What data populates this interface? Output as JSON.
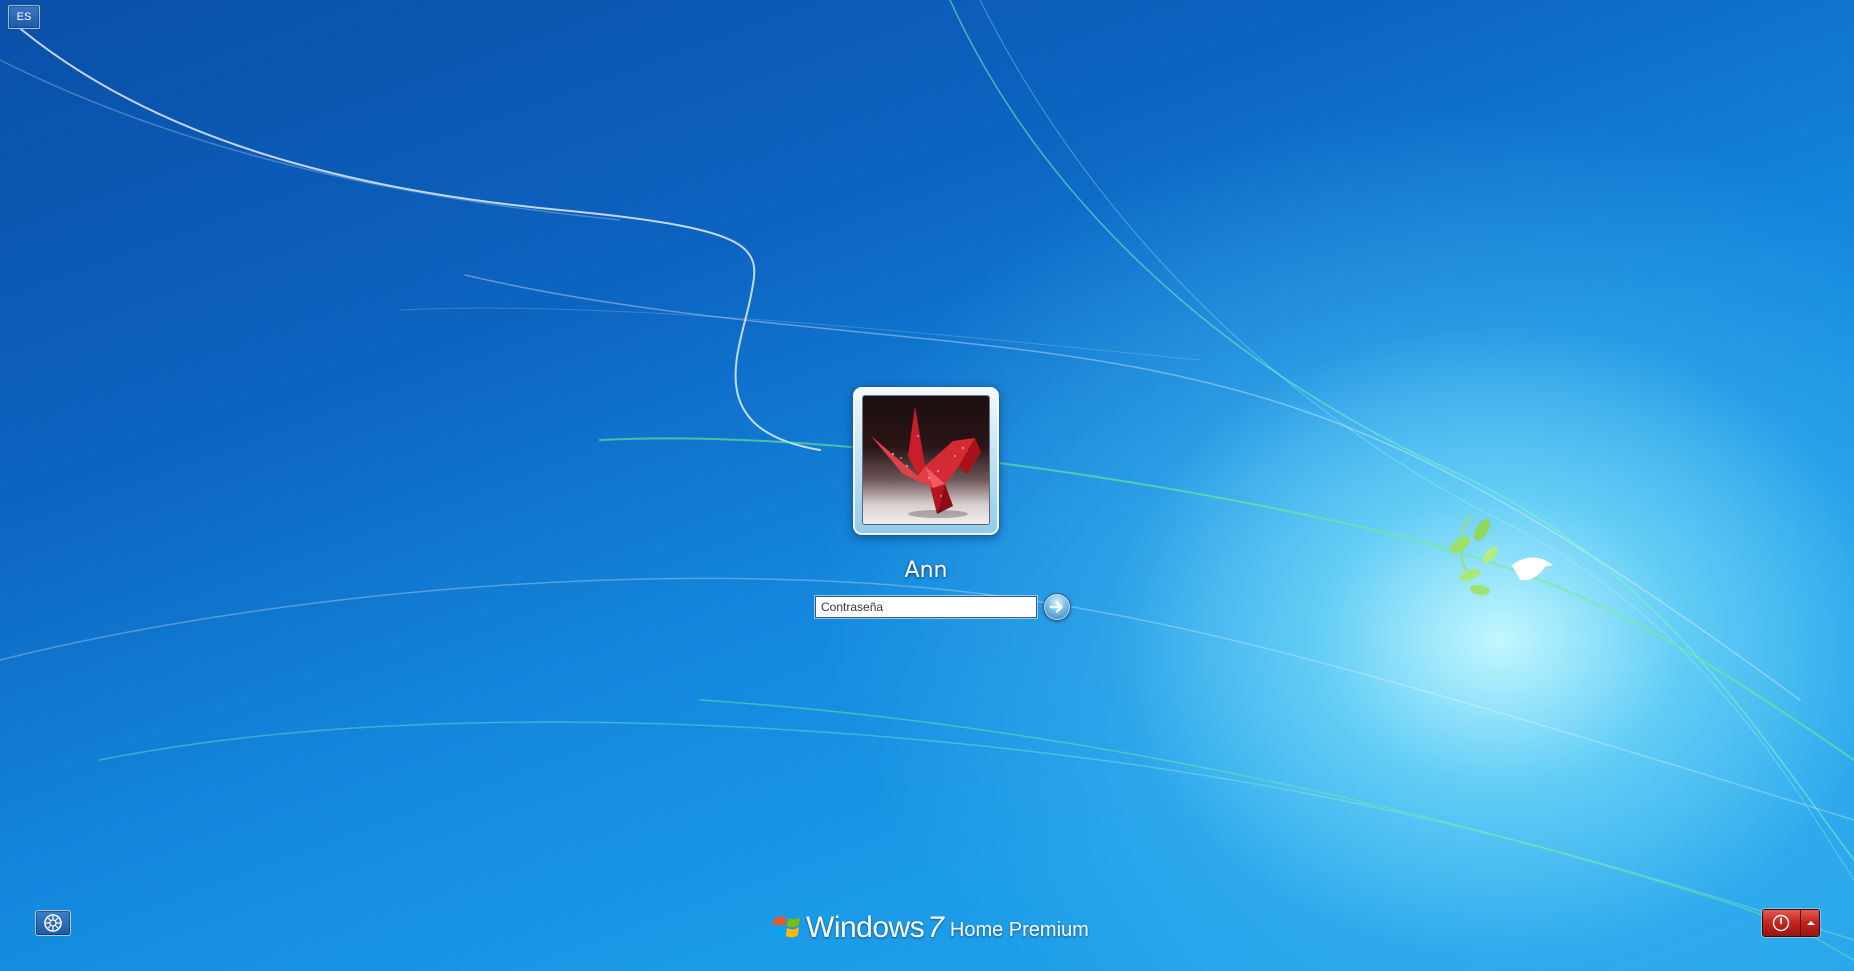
{
  "language": {
    "code": "ES"
  },
  "user": {
    "name": "Ann",
    "picture_icon": "origami-crane-icon"
  },
  "password": {
    "placeholder": "Contraseña",
    "value": ""
  },
  "submit": {
    "icon": "arrow-right-icon"
  },
  "ease_of_access": {
    "icon": "ease-of-access-icon"
  },
  "branding": {
    "name": "Windows",
    "version": "7",
    "edition": "Home Premium",
    "logo_icon": "windows-flag-icon"
  },
  "power": {
    "icon": "power-icon",
    "options_icon": "chevron-up-icon",
    "color": "#c1241c"
  },
  "theme": {
    "background_color": "#1488de",
    "accent_color": "#2f79b8"
  }
}
